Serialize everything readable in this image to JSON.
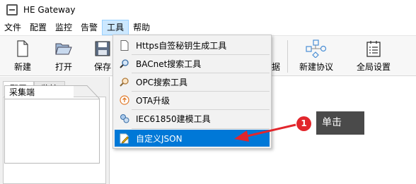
{
  "window": {
    "title": "HE Gateway"
  },
  "menubar": {
    "items": [
      "文件",
      "配置",
      "监控",
      "告警",
      "工具",
      "帮助"
    ],
    "active_index": 4
  },
  "toolbar": {
    "new_label": "新建",
    "open_label": "打开",
    "save_label": "保存",
    "partial_label": "据",
    "new_protocol_label": "新建协议",
    "global_settings_label": "全局设置"
  },
  "left_panel": {
    "tabs": [
      "配置",
      "监控"
    ],
    "collect_header": "采集端"
  },
  "tools_menu": {
    "items": [
      {
        "label": "Https自签秘钥生成工具",
        "icon": "document-icon"
      },
      {
        "label": "BACnet搜索工具",
        "icon": "search-magnifier-icon"
      },
      {
        "label": "OPC搜索工具",
        "icon": "opc-search-icon"
      },
      {
        "label": "OTA升级",
        "icon": "upgrade-arrow-icon"
      },
      {
        "label": "IEC61850建模工具",
        "icon": "modeling-icon"
      },
      {
        "label": "自定义JSON",
        "icon": "edit-json-icon"
      }
    ],
    "highlighted_index": 5
  },
  "annotation": {
    "badge_number": "1",
    "callout_text": "单击"
  },
  "colors": {
    "highlight": "#0078d7",
    "badge": "#e2262c",
    "callout_bg": "#4a4a4a"
  }
}
